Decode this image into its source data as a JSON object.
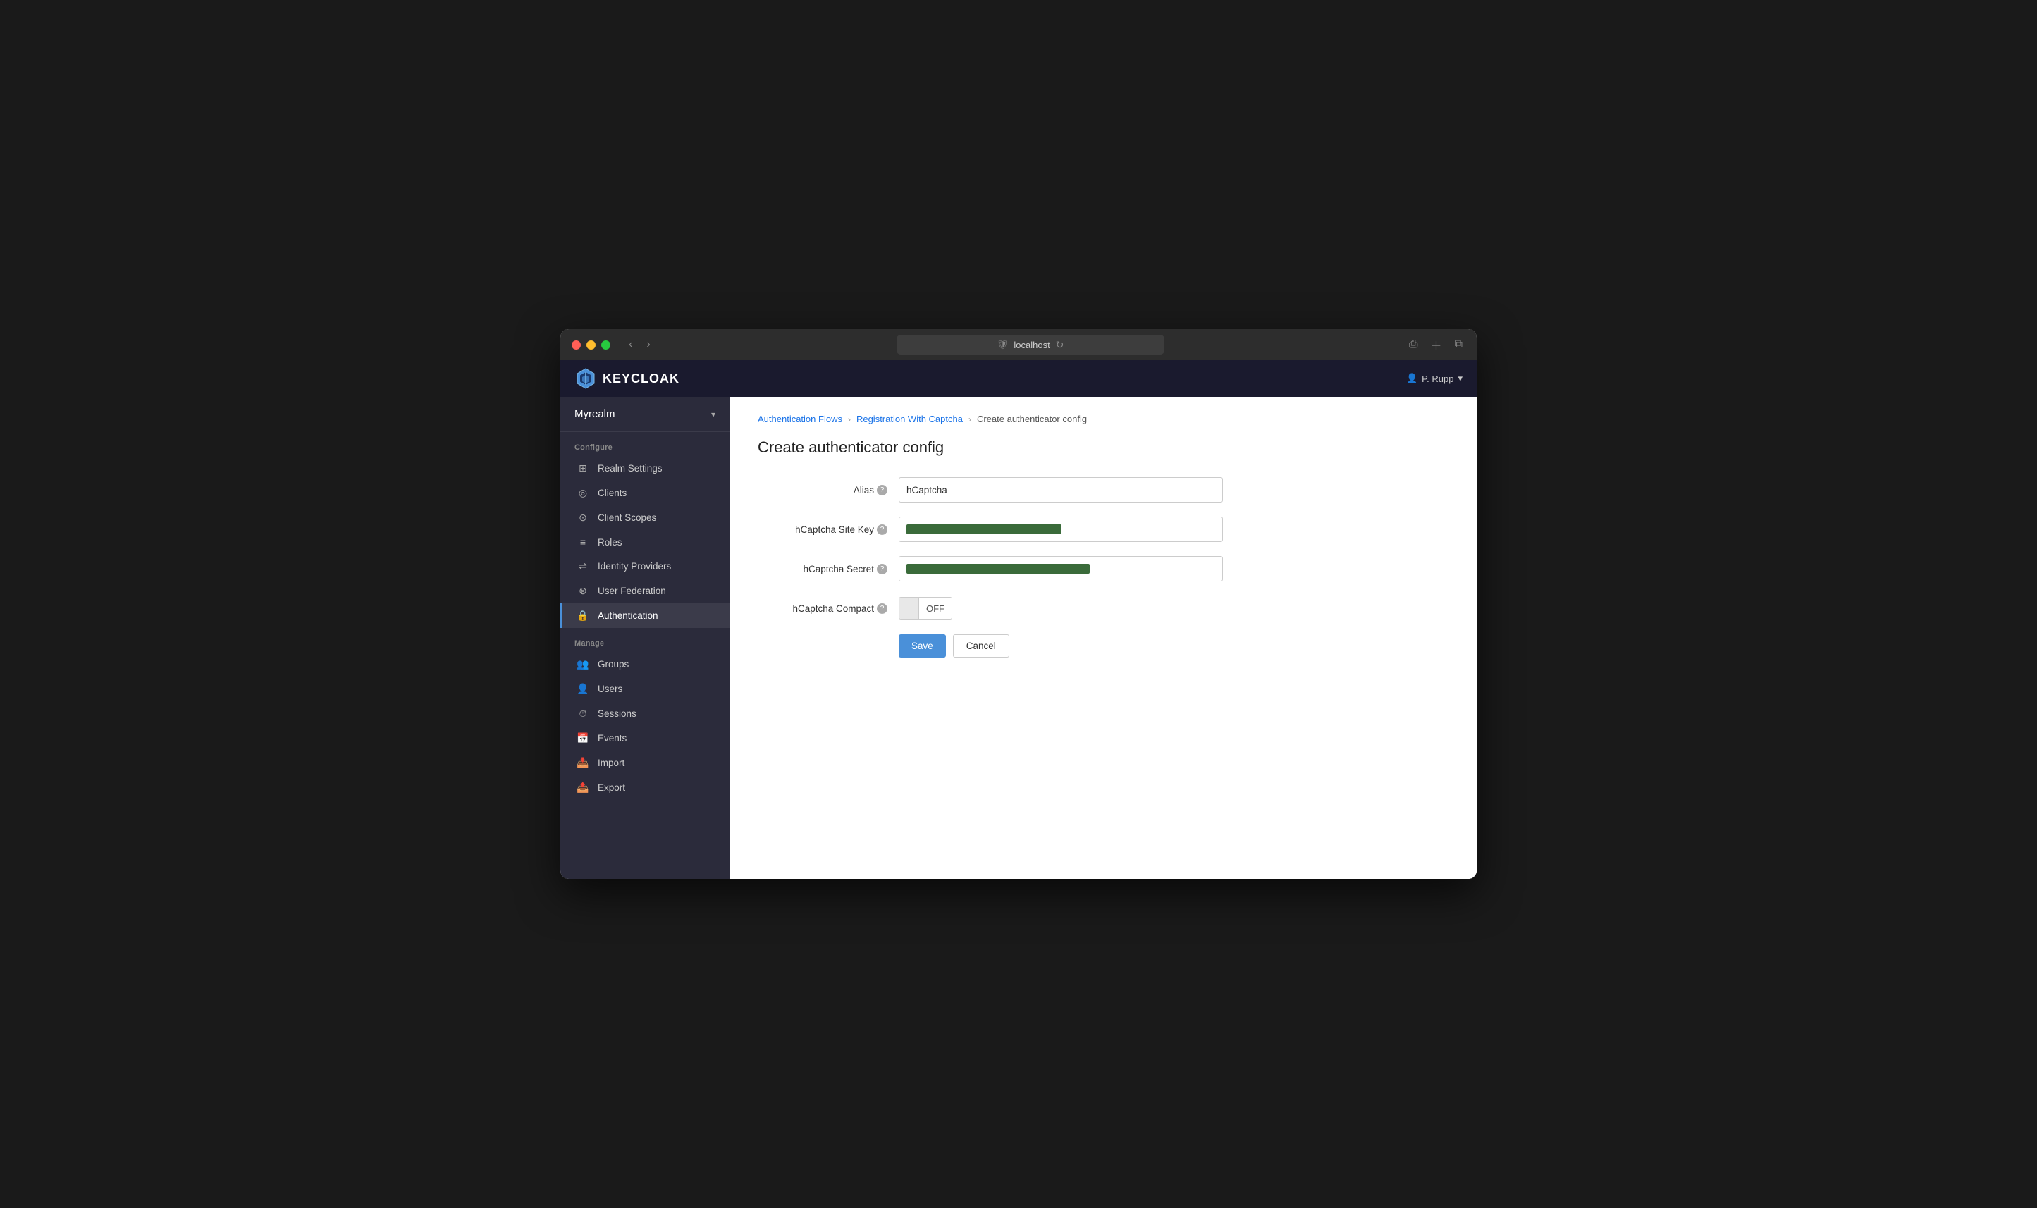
{
  "browser": {
    "url": "localhost",
    "shield_symbol": "🛡",
    "reload_symbol": "↻"
  },
  "header": {
    "logo_text": "KEYCLOAK",
    "user_label": "P. Rupp",
    "user_icon": "👤"
  },
  "sidebar": {
    "realm_name": "Myrealm",
    "sections": [
      {
        "label": "Configure",
        "items": [
          {
            "id": "realm-settings",
            "label": "Realm Settings",
            "icon": "⊞"
          },
          {
            "id": "clients",
            "label": "Clients",
            "icon": "◎"
          },
          {
            "id": "client-scopes",
            "label": "Client Scopes",
            "icon": "⊙"
          },
          {
            "id": "roles",
            "label": "Roles",
            "icon": "≡"
          },
          {
            "id": "identity-providers",
            "label": "Identity Providers",
            "icon": "⇌"
          },
          {
            "id": "user-federation",
            "label": "User Federation",
            "icon": "⊗"
          },
          {
            "id": "authentication",
            "label": "Authentication",
            "icon": "🔒",
            "active": true
          }
        ]
      },
      {
        "label": "Manage",
        "items": [
          {
            "id": "groups",
            "label": "Groups",
            "icon": "👥"
          },
          {
            "id": "users",
            "label": "Users",
            "icon": "👤"
          },
          {
            "id": "sessions",
            "label": "Sessions",
            "icon": "⏱"
          },
          {
            "id": "events",
            "label": "Events",
            "icon": "📅"
          },
          {
            "id": "import",
            "label": "Import",
            "icon": "📥"
          },
          {
            "id": "export",
            "label": "Export",
            "icon": "📤"
          }
        ]
      }
    ]
  },
  "breadcrumb": {
    "links": [
      {
        "label": "Authentication Flows",
        "href": "#"
      },
      {
        "label": "Registration With Captcha",
        "href": "#"
      }
    ],
    "current": "Create authenticator config"
  },
  "page": {
    "title": "Create authenticator config",
    "form": {
      "alias_label": "Alias",
      "alias_value": "hCaptcha",
      "alias_placeholder": "hCaptcha",
      "site_key_label": "hCaptcha Site Key",
      "secret_label": "hCaptcha Secret",
      "compact_label": "hCaptcha Compact",
      "toggle_off_label": "OFF",
      "save_btn": "Save",
      "cancel_btn": "Cancel"
    }
  }
}
